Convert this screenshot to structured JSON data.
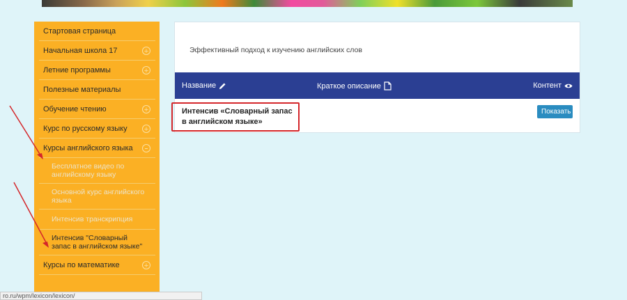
{
  "sidebar": {
    "items": [
      {
        "label": "Стартовая страница",
        "toggle": "none"
      },
      {
        "label": "Начальная школа 17",
        "toggle": "plus"
      },
      {
        "label": "Летние программы",
        "toggle": "plus"
      },
      {
        "label": "Полезные материалы",
        "toggle": "none"
      },
      {
        "label": "Обучение чтению",
        "toggle": "plus"
      },
      {
        "label": "Курс по русскому языку",
        "toggle": "plus"
      },
      {
        "label": "Курсы английского языка",
        "toggle": "minus"
      }
    ],
    "subitems": [
      {
        "label": "Бесплатное видео по английскому языку"
      },
      {
        "label": "Основной курс английского языка"
      },
      {
        "label": "Интенсив транскрипция"
      },
      {
        "label": "Интенсив \"Словарный запас в английском языке\""
      }
    ],
    "last_item": {
      "label": "Курсы по математике",
      "toggle": "plus"
    },
    "plus_glyph": "+"
  },
  "main": {
    "subtitle": "Эффективный подход к изучению английских слов",
    "columns": {
      "name": "Название",
      "description": "Краткое описание",
      "content": "Контент"
    },
    "rows": [
      {
        "title": "Интенсив «Словарный запас в английском языке»",
        "button": "Показать"
      }
    ]
  },
  "status_bar": {
    "url": "ro.ru/wpm/lexicon/lexicon/"
  },
  "colors": {
    "sidebar_bg": "#fbb024",
    "table_header_bg": "#2b3f93",
    "button_bg": "#2a8cc0",
    "highlight": "#d4262a",
    "page_bg": "#dff4f9"
  },
  "icons": {
    "name_column": "pencil-icon",
    "description_column": "document-icon",
    "content_column": "eye-icon"
  }
}
